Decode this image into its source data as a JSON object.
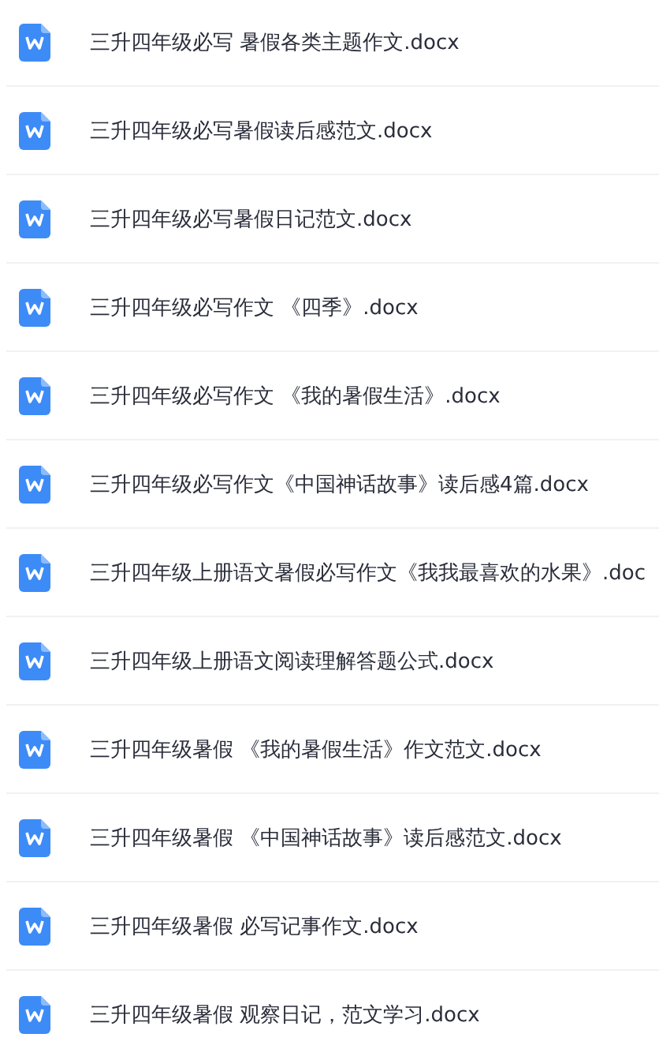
{
  "files": [
    {
      "name": "三升四年级必写 暑假各类主题作文.docx"
    },
    {
      "name": "三升四年级必写暑假读后感范文.docx"
    },
    {
      "name": "三升四年级必写暑假日记范文.docx"
    },
    {
      "name": "三升四年级必写作文 《四季》.docx"
    },
    {
      "name": "三升四年级必写作文 《我的暑假生活》.docx"
    },
    {
      "name": "三升四年级必写作文《中国神话故事》读后感4篇.docx"
    },
    {
      "name": "三升四年级上册语文暑假必写作文《我我最喜欢的水果》.doc"
    },
    {
      "name": "三升四年级上册语文阅读理解答题公式.docx"
    },
    {
      "name": "三升四年级暑假 《我的暑假生活》作文范文.docx"
    },
    {
      "name": "三升四年级暑假 《中国神话故事》读后感范文.docx"
    },
    {
      "name": "三升四年级暑假 必写记事作文.docx"
    },
    {
      "name": "三升四年级暑假 观察日记，范文学习.docx"
    }
  ]
}
